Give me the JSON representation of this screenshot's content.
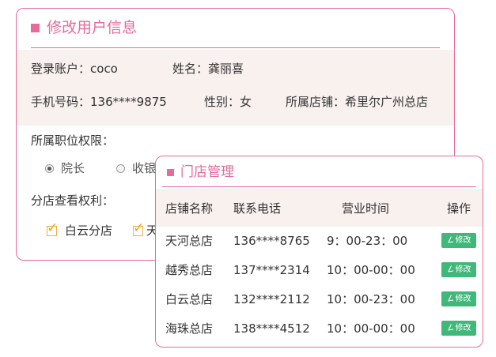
{
  "user_card": {
    "title": "修改用户信息",
    "login_account_label": "登录账户：",
    "login_account_value": "coco",
    "name_label": "姓名：",
    "name_value": "龚丽喜",
    "phone_label": "手机号码：",
    "phone_value": "136****9875",
    "gender_label": "性别：",
    "gender_value": "女",
    "store_label": "所属店铺：",
    "store_value": "希里尔广州总店",
    "role_section_label": "所属职位权限：",
    "roles": [
      {
        "label": "院长",
        "checked": true
      },
      {
        "label": "收银",
        "checked": false
      }
    ],
    "branch_section_label": "分店查看权利：",
    "branches": [
      {
        "label": "白云分店",
        "checked": true
      },
      {
        "label": "天",
        "checked": true
      }
    ]
  },
  "store_card": {
    "title": "门店管理",
    "columns": [
      "店铺名称",
      "联系电话",
      "营业时间",
      "操作"
    ],
    "rows": [
      {
        "name": "天河总店",
        "phone": "136****8765",
        "hours": "9：00-23：00",
        "action": "修改"
      },
      {
        "name": "越秀总店",
        "phone": "137****2314",
        "hours": "10：00-00：00",
        "action": "修改"
      },
      {
        "name": "白云总店",
        "phone": "132****2112",
        "hours": "10：00-23：00",
        "action": "修改"
      },
      {
        "name": "海珠总店",
        "phone": "138****4512",
        "hours": "10：00-00：00",
        "action": "修改"
      }
    ]
  },
  "colors": {
    "accent_pink": "#e86a9a",
    "panel_bg": "#f8f1ee",
    "edit_green": "#3fb87a",
    "checkbox_orange": "#f0a020"
  },
  "icons": {
    "title_marker": "pink-square-icon",
    "edit": "pencil-icon",
    "check": "checkmark-icon"
  }
}
